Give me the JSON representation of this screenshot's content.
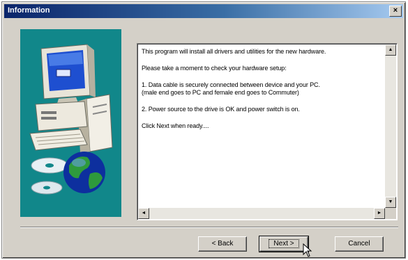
{
  "window": {
    "title": "Information",
    "close_glyph": "×"
  },
  "message": {
    "paragraphs": [
      "This program will install all drivers and utilities for the new hardware.",
      "Please take a moment to check your hardware setup:",
      "1. Data cable is securely connected between device and your PC.\n   (male end goes to PC and female end goes to Commuter)",
      "2. Power source to the drive is OK and power switch is on.",
      "Click Next when ready...."
    ]
  },
  "scrollbar": {
    "up_icon": "▲",
    "down_icon": "▼",
    "left_icon": "◄",
    "right_icon": "►"
  },
  "buttons": {
    "back": "< Back",
    "next": "Next >",
    "cancel": "Cancel"
  },
  "colors": {
    "titlebar_start": "#0a246a",
    "titlebar_end": "#a6caf0",
    "art_panel": "#11878a",
    "dialog_face": "#d4d0c8"
  },
  "icons": [
    "computer-icon",
    "cd-disc-icon",
    "globe-icon",
    "close-icon",
    "mouse-cursor-icon"
  ]
}
